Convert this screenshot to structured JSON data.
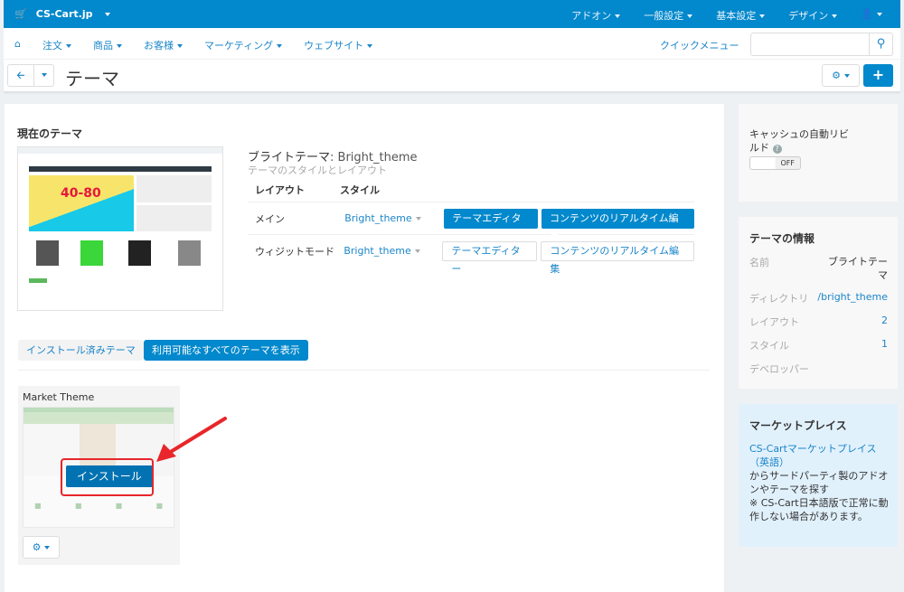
{
  "topbar": {
    "brand": "CS-Cart.jp",
    "menus": [
      "アドオン",
      "一般設定",
      "基本設定",
      "デザイン"
    ],
    "user_icon": "user-icon"
  },
  "navbar": {
    "items": [
      "注文",
      "商品",
      "お客様",
      "マーケティング",
      "ウェブサイト"
    ],
    "quick_menu": "クイックメニュー",
    "search_placeholder": ""
  },
  "toolbar": {
    "title": "テーマ"
  },
  "current": {
    "heading": "現在のテーマ",
    "theme_name": "ブライトテーマ",
    "theme_dir": ": Bright_theme",
    "subtitle": "テーマのスタイルとレイアウト",
    "preview": {
      "promo": "40-80"
    },
    "col_layout": "レイアウト",
    "col_style": "スタイル",
    "rows": [
      {
        "layout": "メイン",
        "style": "Bright_theme",
        "editor": "テーマエディター",
        "live": "コンテンツのリアルタイム編集",
        "active": true
      },
      {
        "layout": "ウィジットモード",
        "style": "Bright_theme",
        "editor": "テーマエディター",
        "live": "コンテンツのリアルタイム編集",
        "active": false
      }
    ]
  },
  "tabs": {
    "installed": "インストール済みテーマ",
    "available": "利用可能なすべてのテーマを表示"
  },
  "market_theme": {
    "name": "Market Theme",
    "install": "インストール"
  },
  "sidebar": {
    "cache": {
      "label": "キャッシュの自動リビルド",
      "toggle": "OFF"
    },
    "info": {
      "heading": "テーマの情報",
      "rows": [
        {
          "k": "名前",
          "v": "ブライトテーマ"
        },
        {
          "k": "ディレクトリ",
          "v": "/bright_theme"
        },
        {
          "k": "レイアウト",
          "v": "2"
        },
        {
          "k": "スタイル",
          "v": "1"
        },
        {
          "k": "デベロッパー",
          "v": ""
        }
      ]
    },
    "market": {
      "heading": "マーケットプレイス",
      "link": "CS-Cartマーケットプレイス（英語）",
      "text1": "からサードパーティ製のアドオンやテーマを探す",
      "text2": "※ CS-Cart日本語版で正常に動作しない場合があります。"
    }
  },
  "colors": {
    "primary": "#0288cc",
    "annotation": "#e8262b"
  }
}
